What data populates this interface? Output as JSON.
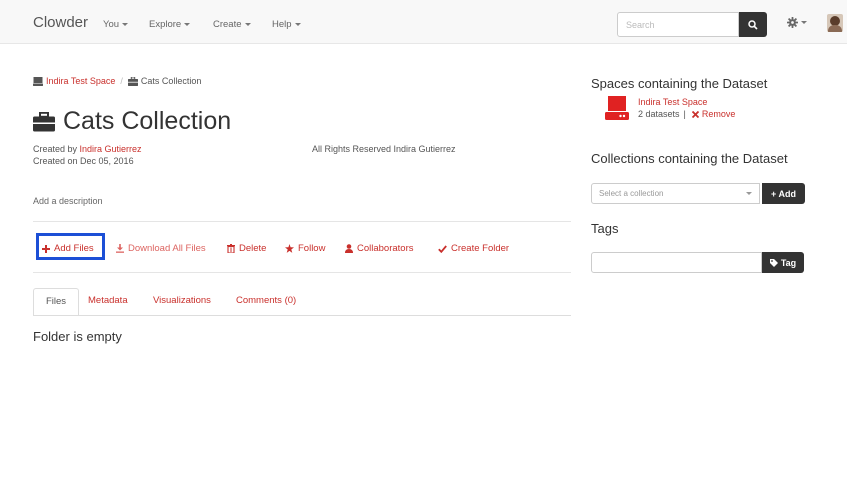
{
  "navbar": {
    "brand": "Clowder",
    "items": [
      {
        "label": "You",
        "has_caret": true
      },
      {
        "label": "Explore",
        "has_caret": true
      },
      {
        "label": "Create",
        "has_caret": true
      },
      {
        "label": "Help",
        "has_caret": true
      }
    ],
    "search_placeholder": "Search",
    "search_icon": "search-icon",
    "settings_icon": "gear-icon"
  },
  "breadcrumb": {
    "space": "Indira Test Space",
    "separator": "/",
    "current": "Cats Collection"
  },
  "collection": {
    "title": "Cats Collection",
    "created_by_prefix": "Created by ",
    "creator": "Indira Gutierrez",
    "created_on": "Created on Dec 05, 2016",
    "license": "All Rights Reserved Indira Gutierrez",
    "description_placeholder": "Add a description"
  },
  "actions": {
    "add_files": "Add Files",
    "download_all": "Download All Files",
    "delete": "Delete",
    "follow": "Follow",
    "collaborators": "Collaborators",
    "create_folder": "Create Folder"
  },
  "tabs": [
    {
      "label": "Files",
      "active": true
    },
    {
      "label": "Metadata",
      "active": false
    },
    {
      "label": "Visualizations",
      "active": false
    },
    {
      "label": "Comments (0)",
      "active": false
    }
  ],
  "files": {
    "empty_message": "Folder is empty"
  },
  "sidebar": {
    "spaces_heading": "Spaces containing the Dataset",
    "space": {
      "name": "Indira Test Space",
      "datasets": "2 datasets",
      "separator": "|",
      "remove": "Remove"
    },
    "collections_heading": "Collections containing the Dataset",
    "collection_select_placeholder": "Select a collection",
    "add_button": "+ Add",
    "tags_heading": "Tags",
    "tag_button": "Tag"
  },
  "colors": {
    "accent": "#c9302c",
    "highlight_box": "#1c4fd6",
    "dark_button": "#333333"
  }
}
